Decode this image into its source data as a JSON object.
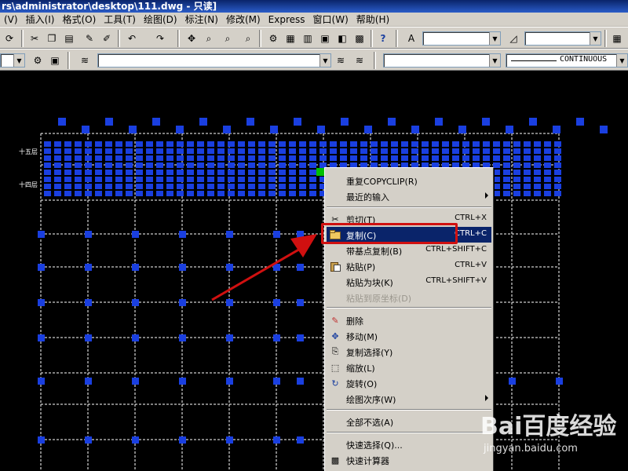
{
  "window": {
    "title": "rs\\administrator\\desktop\\111.dwg - 只读]"
  },
  "menubar": {
    "items": [
      "(V)",
      "插入(I)",
      "格式(O)",
      "工具(T)",
      "绘图(D)",
      "标注(N)",
      "修改(M)",
      "Express",
      "窗口(W)",
      "帮助(H)"
    ]
  },
  "toolbar2": {
    "linetype_value": "CONTINUOUS"
  },
  "drawing": {
    "row_labels": [
      "十五层",
      "十四层"
    ]
  },
  "context_menu": {
    "items": [
      {
        "label": "重复COPYCLIP(R)",
        "shortcut": "",
        "submenu": false,
        "disabled": false,
        "icon": ""
      },
      {
        "label": "最近的输入",
        "shortcut": "",
        "submenu": true,
        "disabled": false,
        "icon": ""
      },
      {
        "label": "剪切(T)",
        "shortcut": "CTRL+X",
        "submenu": false,
        "disabled": false,
        "icon": "scissors-icon"
      },
      {
        "label": "复制(C)",
        "shortcut": "CTRL+C",
        "submenu": false,
        "disabled": false,
        "icon": "copy-icon",
        "highlighted": true
      },
      {
        "label": "带基点复制(B)",
        "shortcut": "CTRL+SHIFT+C",
        "submenu": false,
        "disabled": false,
        "icon": ""
      },
      {
        "label": "粘贴(P)",
        "shortcut": "CTRL+V",
        "submenu": false,
        "disabled": false,
        "icon": "paste-icon"
      },
      {
        "label": "粘贴为块(K)",
        "shortcut": "CTRL+SHIFT+V",
        "submenu": false,
        "disabled": false,
        "icon": ""
      },
      {
        "label": "粘贴到原坐标(D)",
        "shortcut": "",
        "submenu": false,
        "disabled": true,
        "icon": ""
      },
      {
        "label": "删除",
        "shortcut": "",
        "submenu": false,
        "disabled": false,
        "icon": "eraser-icon"
      },
      {
        "label": "移动(M)",
        "shortcut": "",
        "submenu": false,
        "disabled": false,
        "icon": "move-icon"
      },
      {
        "label": "复制选择(Y)",
        "shortcut": "",
        "submenu": false,
        "disabled": false,
        "icon": "copy-object-icon"
      },
      {
        "label": "缩放(L)",
        "shortcut": "",
        "submenu": false,
        "disabled": false,
        "icon": "scale-icon"
      },
      {
        "label": "旋转(O)",
        "shortcut": "",
        "submenu": false,
        "disabled": false,
        "icon": "rotate-icon"
      },
      {
        "label": "绘图次序(W)",
        "shortcut": "",
        "submenu": true,
        "disabled": false,
        "icon": ""
      },
      {
        "label": "全部不选(A)",
        "shortcut": "",
        "submenu": false,
        "disabled": false,
        "icon": ""
      },
      {
        "label": "快速选择(Q)...",
        "shortcut": "",
        "submenu": false,
        "disabled": false,
        "icon": ""
      },
      {
        "label": "快速计算器",
        "shortcut": "",
        "submenu": false,
        "disabled": false,
        "icon": "calculator-icon"
      }
    ]
  },
  "watermark": {
    "logo": "Bai百度经验",
    "url": "jingyan.baidu.com"
  },
  "colors": {
    "grip": "#1a3fe0",
    "selected_grip": "#00c000",
    "highlight": "#0a246a",
    "annotation": "#d01010"
  }
}
